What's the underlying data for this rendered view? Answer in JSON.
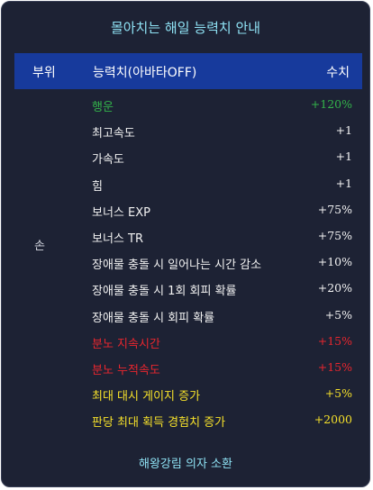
{
  "title": "몰아치는 해일 능력치 안내",
  "header": {
    "part": "부위",
    "stat": "능력치(아바타OFF)",
    "value": "수치"
  },
  "part_label": "손",
  "rows": [
    {
      "name": "행운",
      "value": "+120%",
      "color": "#33b24a"
    },
    {
      "name": "최고속도",
      "value": "+1",
      "color": "#f2f2f2"
    },
    {
      "name": "가속도",
      "value": "+1",
      "color": "#f2f2f2"
    },
    {
      "name": "힘",
      "value": "+1",
      "color": "#f2f2f2"
    },
    {
      "name": "보너스 EXP",
      "value": "+75%",
      "color": "#f2f2f2"
    },
    {
      "name": "보너스 TR",
      "value": "+75%",
      "color": "#f2f2f2"
    },
    {
      "name": "장애물 충돌 시 일어나는 시간 감소",
      "value": "+10%",
      "color": "#f2f2f2"
    },
    {
      "name": "장애물 충돌 시 1회 회피 확률",
      "value": "+20%",
      "color": "#f2f2f2"
    },
    {
      "name": "장애물 충돌 시 회피 확률",
      "value": "+5%",
      "color": "#f2f2f2"
    },
    {
      "name": "분노 지속시간",
      "value": "+15%",
      "color": "#e8262e"
    },
    {
      "name": "분노 누적속도",
      "value": "+15%",
      "color": "#e8262e"
    },
    {
      "name": "최대 대시 게이지 증가",
      "value": "+5%",
      "color": "#f5e02a"
    },
    {
      "name": "판당 최대 획득 경험치 증가",
      "value": "+2000",
      "color": "#f5e02a"
    }
  ],
  "footer": "해왕강림 의자 소환"
}
